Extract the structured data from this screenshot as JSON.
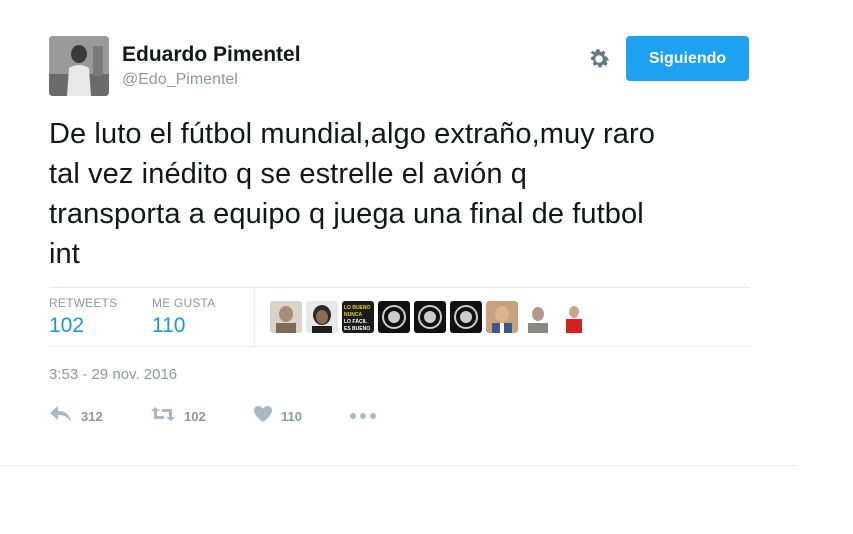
{
  "author": {
    "name": "Eduardo Pimentel",
    "handle": "@Edo_Pimentel"
  },
  "follow_button": {
    "label": "Siguiendo"
  },
  "tweet": {
    "lines": [
      "De luto el fútbol mundial,algo extraño,muy raro",
      "tal vez inédito q se estrelle el avión q",
      "transporta a equipo q juega una final de futbol",
      "int"
    ]
  },
  "stats": {
    "retweets": {
      "label": "RETWEETS",
      "value": "102"
    },
    "likes": {
      "label": "ME GUSTA",
      "value": "110"
    },
    "liker_avatars": [
      {
        "name": "liker-avatar-1"
      },
      {
        "name": "liker-avatar-2"
      },
      {
        "name": "liker-avatar-3"
      },
      {
        "name": "liker-avatar-4"
      },
      {
        "name": "liker-avatar-5"
      },
      {
        "name": "liker-avatar-6"
      },
      {
        "name": "liker-avatar-7"
      },
      {
        "name": "liker-avatar-8"
      },
      {
        "name": "liker-avatar-9"
      }
    ],
    "logo_text": "LO BUENO NUNCA LO FÁCIL NUNCA ES BUENO"
  },
  "timestamp": "3:53 - 29 nov. 2016",
  "actions": {
    "reply_count": "312",
    "retweet_count": "102",
    "like_count": "110"
  },
  "colors": {
    "accent": "#1da1f2",
    "stat_value": "#1b95e0",
    "muted": "#8899a6",
    "border": "#e6ecf0"
  }
}
